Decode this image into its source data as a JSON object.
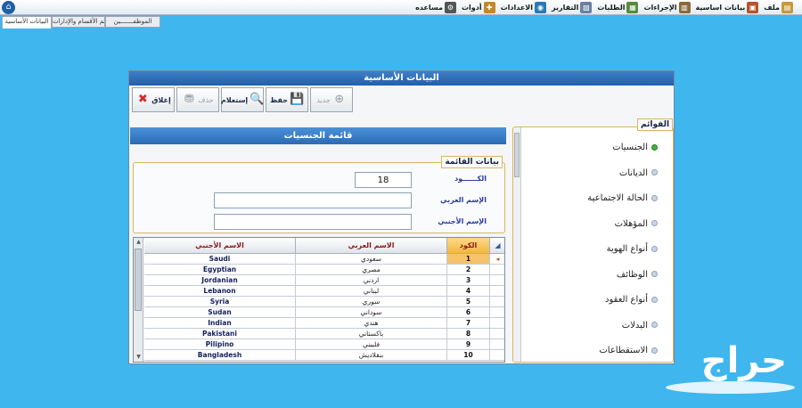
{
  "menubar": {
    "items": [
      {
        "label": "ملف",
        "icon": "folder-icon",
        "color": "#c89a3a"
      },
      {
        "label": "بيانات اساسية",
        "icon": "box-icon",
        "color": "#b5542e"
      },
      {
        "label": "الإجراءات",
        "icon": "notebook-icon",
        "color": "#8b6a3a"
      },
      {
        "label": "الطلبات",
        "icon": "clipboard-icon",
        "color": "#5a8a3a"
      },
      {
        "label": "التقارير",
        "icon": "chart-icon",
        "color": "#6b7fa0"
      },
      {
        "label": "الاعدادات",
        "icon": "globe-icon",
        "color": "#2a78b8"
      },
      {
        "label": "أدوات",
        "icon": "tools-icon",
        "color": "#c08a2a"
      },
      {
        "label": "مساعده",
        "icon": "gears-icon",
        "color": "#555555"
      }
    ]
  },
  "tabs": [
    {
      "label": "البيانات الأساسية",
      "active": true
    },
    {
      "label": "قوائم الأقسام والإدارات",
      "active": false
    },
    {
      "label": "الموظفـــــــين",
      "active": false
    }
  ],
  "window": {
    "title": "البيانات الأساسية",
    "toolbar": [
      {
        "label": "جديد",
        "icon": "new-icon",
        "enabled": false
      },
      {
        "label": "حفظ",
        "icon": "save-icon",
        "enabled": true
      },
      {
        "label": "إستعلام",
        "icon": "search-icon",
        "enabled": true
      },
      {
        "label": "حذف",
        "icon": "delete-icon",
        "enabled": false
      },
      {
        "label": "إغلاق",
        "icon": "close-icon",
        "enabled": true
      }
    ],
    "section_title": "قائمة الجنسيات",
    "form": {
      "legend": "بيانات القائمة",
      "code_label": "الكــــــود",
      "code_value": "18",
      "arabic_label": "الإسم العربي",
      "arabic_value": "",
      "foreign_label": "الإسم الأجنبي",
      "foreign_value": ""
    },
    "grid": {
      "headers": {
        "code": "الكود",
        "arabic": "الاسم العربي",
        "foreign": "الاسم الأجنبي"
      },
      "rows": [
        {
          "code": "1",
          "arabic": "سعودي",
          "foreign": "Saudi"
        },
        {
          "code": "2",
          "arabic": "مصري",
          "foreign": "Egyptian"
        },
        {
          "code": "3",
          "arabic": "اردني",
          "foreign": "Jordanian"
        },
        {
          "code": "4",
          "arabic": "لبناني",
          "foreign": "Lebanon"
        },
        {
          "code": "5",
          "arabic": "سوري",
          "foreign": "Syria"
        },
        {
          "code": "6",
          "arabic": "سوداني",
          "foreign": "Sudan"
        },
        {
          "code": "7",
          "arabic": "هندي",
          "foreign": "Indian"
        },
        {
          "code": "8",
          "arabic": "باكستاني",
          "foreign": "Pakistani"
        },
        {
          "code": "9",
          "arabic": "فلبيني",
          "foreign": "Pilipino"
        },
        {
          "code": "10",
          "arabic": "بنقلاديش",
          "foreign": "Bangladesh"
        }
      ],
      "selected_index": 0
    },
    "lists": {
      "legend": "القوائم",
      "items": [
        {
          "label": "الجنسيات",
          "active": true
        },
        {
          "label": "الديانات",
          "active": false
        },
        {
          "label": "الحالة الاجتماعية",
          "active": false
        },
        {
          "label": "المؤهلات",
          "active": false
        },
        {
          "label": "أنواع الهوية",
          "active": false
        },
        {
          "label": "الوظائف",
          "active": false
        },
        {
          "label": "أنواع العقود",
          "active": false
        },
        {
          "label": "البدلات",
          "active": false
        },
        {
          "label": "الاستقطاعات",
          "active": false
        }
      ]
    }
  },
  "watermark": {
    "text": "حراج"
  }
}
